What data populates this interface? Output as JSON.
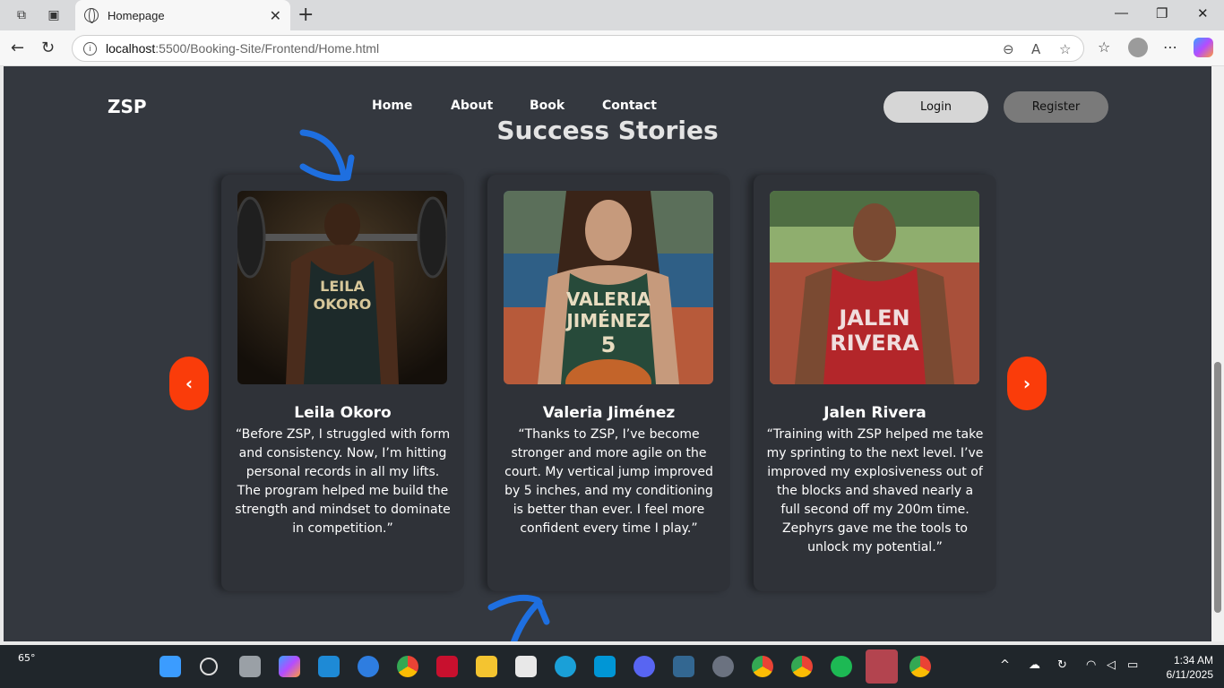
{
  "browser": {
    "tab_title": "Homepage",
    "url_host": "localhost",
    "url_path": ":5500/Booking-Site/Frontend/Home.html"
  },
  "site": {
    "logo": "ZSP",
    "nav": [
      "Home",
      "About",
      "Book",
      "Contact"
    ],
    "login_label": "Login",
    "register_label": "Register"
  },
  "section_title": "Success Stories",
  "carousel": {
    "prev_label": "‹",
    "next_label": "›",
    "cards": [
      {
        "name": "Leila Okoro",
        "jersey_text": "LEILA OKORO",
        "quote": "“Before ZSP, I struggled with form and consistency. Now, I’m hitting personal records in all my lifts. The program helped me build the strength and mindset to dominate in competition.”"
      },
      {
        "name": "Valeria Jiménez",
        "jersey_text": "VALERIA JIMÉNEZ",
        "jersey_number": "5",
        "quote": "“Thanks to ZSP, I’ve become stronger and more agile on the court. My vertical jump improved by 5 inches, and my conditioning is better than ever. I feel more confident every time I play.”"
      },
      {
        "name": "Jalen Rivera",
        "jersey_text": "JALEN RIVERA",
        "quote": "“Training with ZSP helped me take my sprinting to the next level. I’ve improved my explosiveness out of the blocks and shaved nearly a full second off my 200m time. Zephyrs gave me the tools to unlock my potential.”"
      }
    ]
  },
  "taskbar": {
    "weather_temp": "65°",
    "time": "1:34 AM",
    "date": "6/11/2025"
  },
  "colors": {
    "accent": "#fa3c0a",
    "page_bg": "#34383f",
    "card_bg": "#2f3238",
    "annotation": "#1e6fe0"
  }
}
